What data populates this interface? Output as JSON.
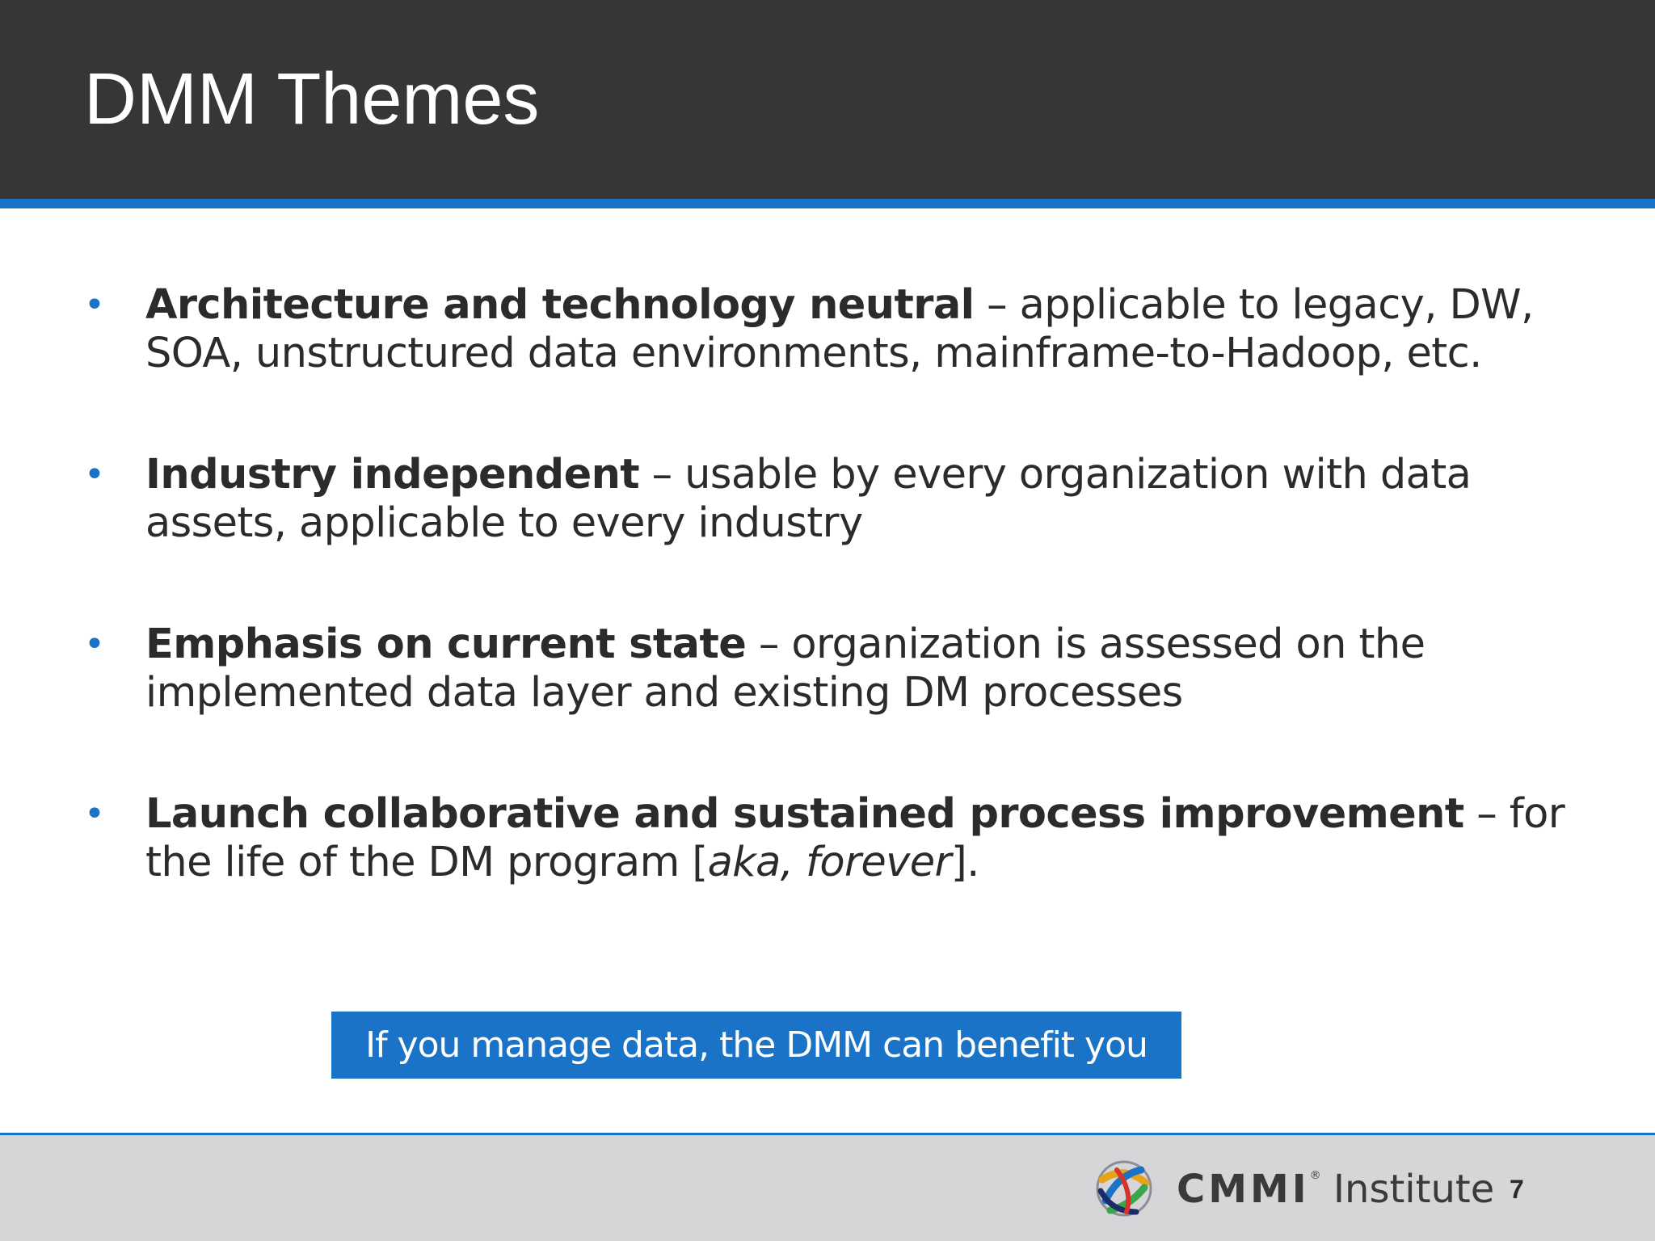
{
  "slide": {
    "title": "DMM Themes",
    "bullets": [
      {
        "bold": "Architecture and technology neutral",
        "rest": " – applicable to legacy, DW, SOA, unstructured data environments, mainframe-to-Hadoop, etc."
      },
      {
        "bold": "Industry independent",
        "rest": " – usable by every organization with data assets, applicable to every industry"
      },
      {
        "bold": "Emphasis on current state",
        "rest": " – organization is assessed on the implemented data layer and existing DM processes"
      },
      {
        "bold": "Launch collaborative and sustained process improvement",
        "rest": " – for the life of the DM program [",
        "italic": "aka, forever",
        "end": "]."
      }
    ],
    "bullet_glyph": "•",
    "callout": "If you manage data, the DMM can benefit you",
    "page_number": "7"
  },
  "footer": {
    "logo_brand": "CMMI",
    "logo_reg": "®",
    "logo_suffix": " Institute",
    "logo_icon": "globe-logo-icon"
  },
  "colors": {
    "title_bar": "#363636",
    "accent": "#1a73c7",
    "footer_bg": "#d6d6d8",
    "text": "#2b2b2b"
  }
}
